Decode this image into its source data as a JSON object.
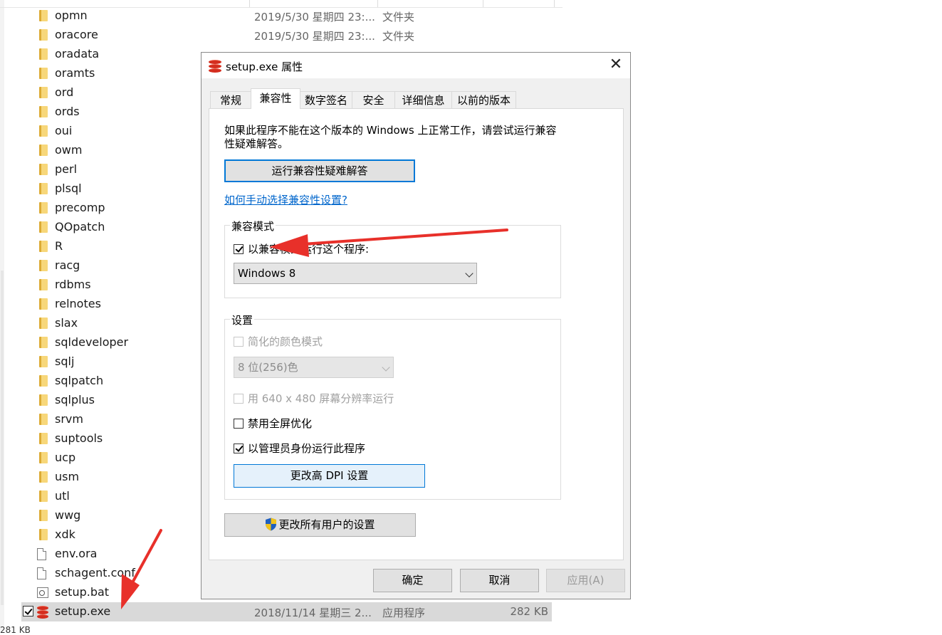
{
  "explorer": {
    "rows": [
      {
        "name": "opmn",
        "date": "2019/5/30 星期四 23:...",
        "type": "文件夹",
        "kind": "folder"
      },
      {
        "name": "oracore",
        "date": "2019/5/30 星期四 23:...",
        "type": "文件夹",
        "kind": "folder"
      },
      {
        "name": "oradata",
        "date": "",
        "type": "",
        "kind": "folder"
      },
      {
        "name": "oramts",
        "kind": "folder"
      },
      {
        "name": "ord",
        "kind": "folder"
      },
      {
        "name": "ords",
        "kind": "folder"
      },
      {
        "name": "oui",
        "kind": "folder"
      },
      {
        "name": "owm",
        "kind": "folder"
      },
      {
        "name": "perl",
        "kind": "folder"
      },
      {
        "name": "plsql",
        "kind": "folder"
      },
      {
        "name": "precomp",
        "kind": "folder"
      },
      {
        "name": "QOpatch",
        "kind": "folder"
      },
      {
        "name": "R",
        "kind": "folder"
      },
      {
        "name": "racg",
        "kind": "folder"
      },
      {
        "name": "rdbms",
        "kind": "folder"
      },
      {
        "name": "relnotes",
        "kind": "folder"
      },
      {
        "name": "slax",
        "kind": "folder"
      },
      {
        "name": "sqldeveloper",
        "kind": "folder"
      },
      {
        "name": "sqlj",
        "kind": "folder"
      },
      {
        "name": "sqlpatch",
        "kind": "folder"
      },
      {
        "name": "sqlplus",
        "kind": "folder"
      },
      {
        "name": "srvm",
        "kind": "folder"
      },
      {
        "name": "suptools",
        "kind": "folder"
      },
      {
        "name": "ucp",
        "kind": "folder"
      },
      {
        "name": "usm",
        "kind": "folder"
      },
      {
        "name": "utl",
        "kind": "folder"
      },
      {
        "name": "wwg",
        "kind": "folder"
      },
      {
        "name": "xdk",
        "kind": "folder"
      },
      {
        "name": "env.ora",
        "kind": "file"
      },
      {
        "name": "schagent.conf",
        "kind": "file"
      },
      {
        "name": "setup.bat",
        "kind": "bat"
      },
      {
        "name": "setup.exe",
        "date": "2018/11/14 星期三 2...",
        "type": "应用程序",
        "size": "282 KB",
        "kind": "exe",
        "selected": true
      }
    ],
    "status_text": "281 KB"
  },
  "dialog": {
    "title": "setup.exe 属性",
    "close_glyph": "✕",
    "tabs": [
      "常规",
      "兼容性",
      "数字签名",
      "安全",
      "详细信息",
      "以前的版本"
    ],
    "active_tab": "兼容性",
    "intro_text": "如果此程序不能在这个版本的 Windows 上正常工作，请尝试运行兼容性疑难解答。",
    "troubleshoot_button": "运行兼容性疑难解答",
    "manual_link": "如何手动选择兼容性设置?",
    "compat_mode": {
      "group_label": "兼容模式",
      "checkbox_label": "以兼容模式运行这个程序:",
      "checked": true,
      "selected_os": "Windows 8"
    },
    "settings": {
      "group_label": "设置",
      "reduced_color_label": "简化的颜色模式",
      "color_select_value": "8 位(256)色",
      "resolution_label": "用 640 x 480 屏幕分辨率运行",
      "fullscreen_label": "禁用全屏优化",
      "admin_label": "以管理员身份运行此程序",
      "dpi_button": "更改高 DPI 设置"
    },
    "all_users_button": "更改所有用户的设置",
    "ok_button": "确定",
    "cancel_button": "取消",
    "apply_button": "应用(A)"
  },
  "colors": {
    "accent": "#0078d7",
    "link": "#0066cc",
    "annotation": "#e8302a",
    "selection": "#d9d9d9"
  }
}
